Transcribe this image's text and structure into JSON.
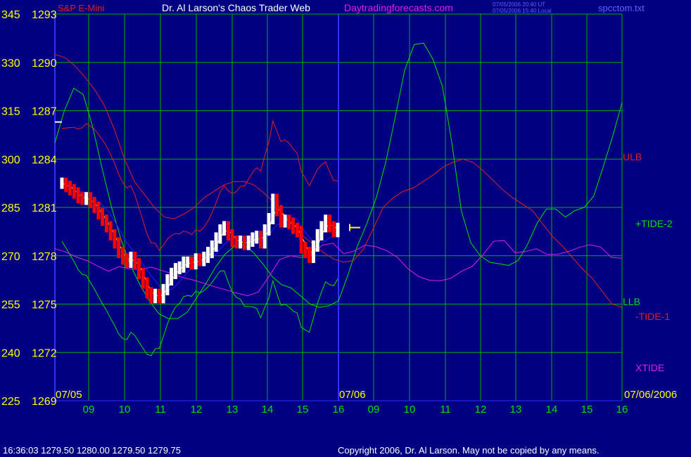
{
  "header": {
    "instrument": "S&P E-Mini",
    "title": "Dr. Al Larson's Chaos Trader Web",
    "website": "Daytradingforecasts.com",
    "timestamp_ut": "07/05/2006 20:40 UT",
    "timestamp_local": "07/05/2006 15:40 Local",
    "file": "spcctom.txt"
  },
  "footer": {
    "quote": "16:36:03  1279.50 1280.00 1279.50 1279.75",
    "copyright": "Copyright 2006, Dr. Al Larson. May not be copied by any means."
  },
  "colors": {
    "background": "#000080",
    "grid": "#00b000",
    "axis": "#3030ff",
    "price_up": "#ffffff",
    "price_down": "#ff0000",
    "yellow": "#ffff00",
    "ulb": "#e02020",
    "tide2": "#00e000",
    "tide1": "#e02020",
    "xtide": "#e020e0",
    "avg": "#2020ff"
  },
  "chart_data": {
    "type": "line",
    "title": "S&P E-Mini",
    "left_axis_values": [
      "345",
      "330",
      "315",
      "300",
      "285",
      "270",
      "255",
      "240",
      "225"
    ],
    "price_axis_values": [
      "1293",
      "1290",
      "1287",
      "1284",
      "1281",
      "1278",
      "1275",
      "1272",
      "1269"
    ],
    "x_tick_labels": [
      "09",
      "10",
      "11",
      "12",
      "13",
      "14",
      "15",
      "16",
      "09",
      "10",
      "11",
      "12",
      "13",
      "14",
      "15",
      "16"
    ],
    "date_labels": {
      "start": "07/05",
      "middle": "07/06",
      "end": "07/06/2006"
    },
    "series_labels": {
      "ulb": "ULB",
      "tide2": "+TIDE-2",
      "llb": "LLB",
      "tide1": "-TIDE-1",
      "xtide": "XTIDE"
    },
    "ylim": [
      1269,
      1293
    ],
    "grid": true,
    "last_price": 1279.75,
    "price_series": [
      1282.5,
      1282.3,
      1282.1,
      1281.9,
      1281.6,
      1281.5,
      1281.6,
      1281.3,
      1281.0,
      1280.6,
      1280.2,
      1279.8,
      1279.3,
      1278.8,
      1278.2,
      1277.8,
      1277.6,
      1277.9,
      1277.5,
      1276.9,
      1276.3,
      1275.7,
      1275.4,
      1275.6,
      1275.4,
      1275.9,
      1276.5,
      1276.9,
      1277.2,
      1277.3,
      1277.6,
      1277.6,
      1277.5,
      1277.8,
      1277.7,
      1277.9,
      1278.2,
      1278.6,
      1279.1,
      1279.6,
      1279.8,
      1279.3,
      1278.9,
      1278.8,
      1278.9,
      1278.7,
      1278.9,
      1279.1,
      1279.2,
      1278.8,
      1279.6,
      1280.3,
      1281.5,
      1280.8,
      1280.1,
      1280.2,
      1280.0,
      1279.7,
      1279.5,
      1278.5,
      1278.2,
      1277.9,
      1278.6,
      1279.3,
      1279.8,
      1280.2,
      1279.8,
      1279.5,
      1279.7
    ],
    "tide2_curve": [
      1285.0,
      1287.0,
      1288.4,
      1288.0,
      1286.0,
      1283.4,
      1281.0,
      1279.0,
      1277.4,
      1276.2,
      1275.2,
      1274.4,
      1274.1,
      1274.1,
      1274.5,
      1275.4,
      1276.3,
      1277.3,
      1278.1,
      1278.6,
      1278.7,
      1278.2,
      1277.5,
      1276.7,
      1276.2,
      1276.0,
      1275.5,
      1275.0,
      1274.8,
      1274.9,
      1275.2,
      1276.8,
      1278.6,
      1280.0,
      1281.6,
      1283.8,
      1286.6,
      1289.5,
      1291.1,
      1291.2,
      1290.2,
      1288.5,
      1285.0,
      1280.8,
      1278.8,
      1278.0,
      1277.6,
      1277.5,
      1277.4,
      1277.7,
      1278.7,
      1280.0,
      1280.9,
      1280.9,
      1280.4,
      1280.8,
      1281.0,
      1281.7,
      1283.5,
      1285.4,
      1287.5
    ],
    "tide1_curve": [
      1290.5,
      1290.3,
      1289.8,
      1289.1,
      1288.3,
      1287.3,
      1285.8,
      1284.0,
      1282.6,
      1281.8,
      1281.0,
      1280.4,
      1280.3,
      1280.6,
      1281.0,
      1281.6,
      1282.0,
      1282.4,
      1282.6,
      1282.6,
      1282.4,
      1281.9,
      1281.3,
      1280.6,
      1279.9,
      1279.2,
      1278.7,
      1278.2,
      1277.8,
      1277.6,
      1277.7,
      1278.4,
      1279.7,
      1281.0,
      1281.6,
      1282.0,
      1282.2,
      1282.6,
      1283.0,
      1283.5,
      1283.8,
      1284.0,
      1283.8,
      1283.3,
      1282.7,
      1282.1,
      1281.6,
      1281.2,
      1280.8,
      1280.0,
      1279.2,
      1278.6,
      1277.9,
      1277.2,
      1276.6,
      1275.8,
      1275.0,
      1274.8
    ],
    "xtide_curve": [
      272.2,
      271.2,
      269.6,
      268.5,
      266.8,
      265.2,
      266.6,
      265.9,
      265.7,
      266.5,
      265.4,
      264.4,
      263.2,
      262.4,
      261.4,
      260.3,
      259.4,
      258.4,
      257.6,
      258.7,
      263.5,
      268.8,
      270.0,
      269.4,
      270.4,
      273.3,
      273.9,
      270.6,
      271.5,
      273.3,
      272.8,
      271.6,
      269.5,
      266.0,
      263.5,
      262.4,
      262.2,
      263.0,
      265.2,
      266.7,
      270.3,
      274.5,
      274.7,
      270.9,
      271.3,
      272.2,
      270.4,
      270.5,
      271.3,
      272.6,
      273.4,
      272.7,
      269.5,
      269.2
    ]
  }
}
